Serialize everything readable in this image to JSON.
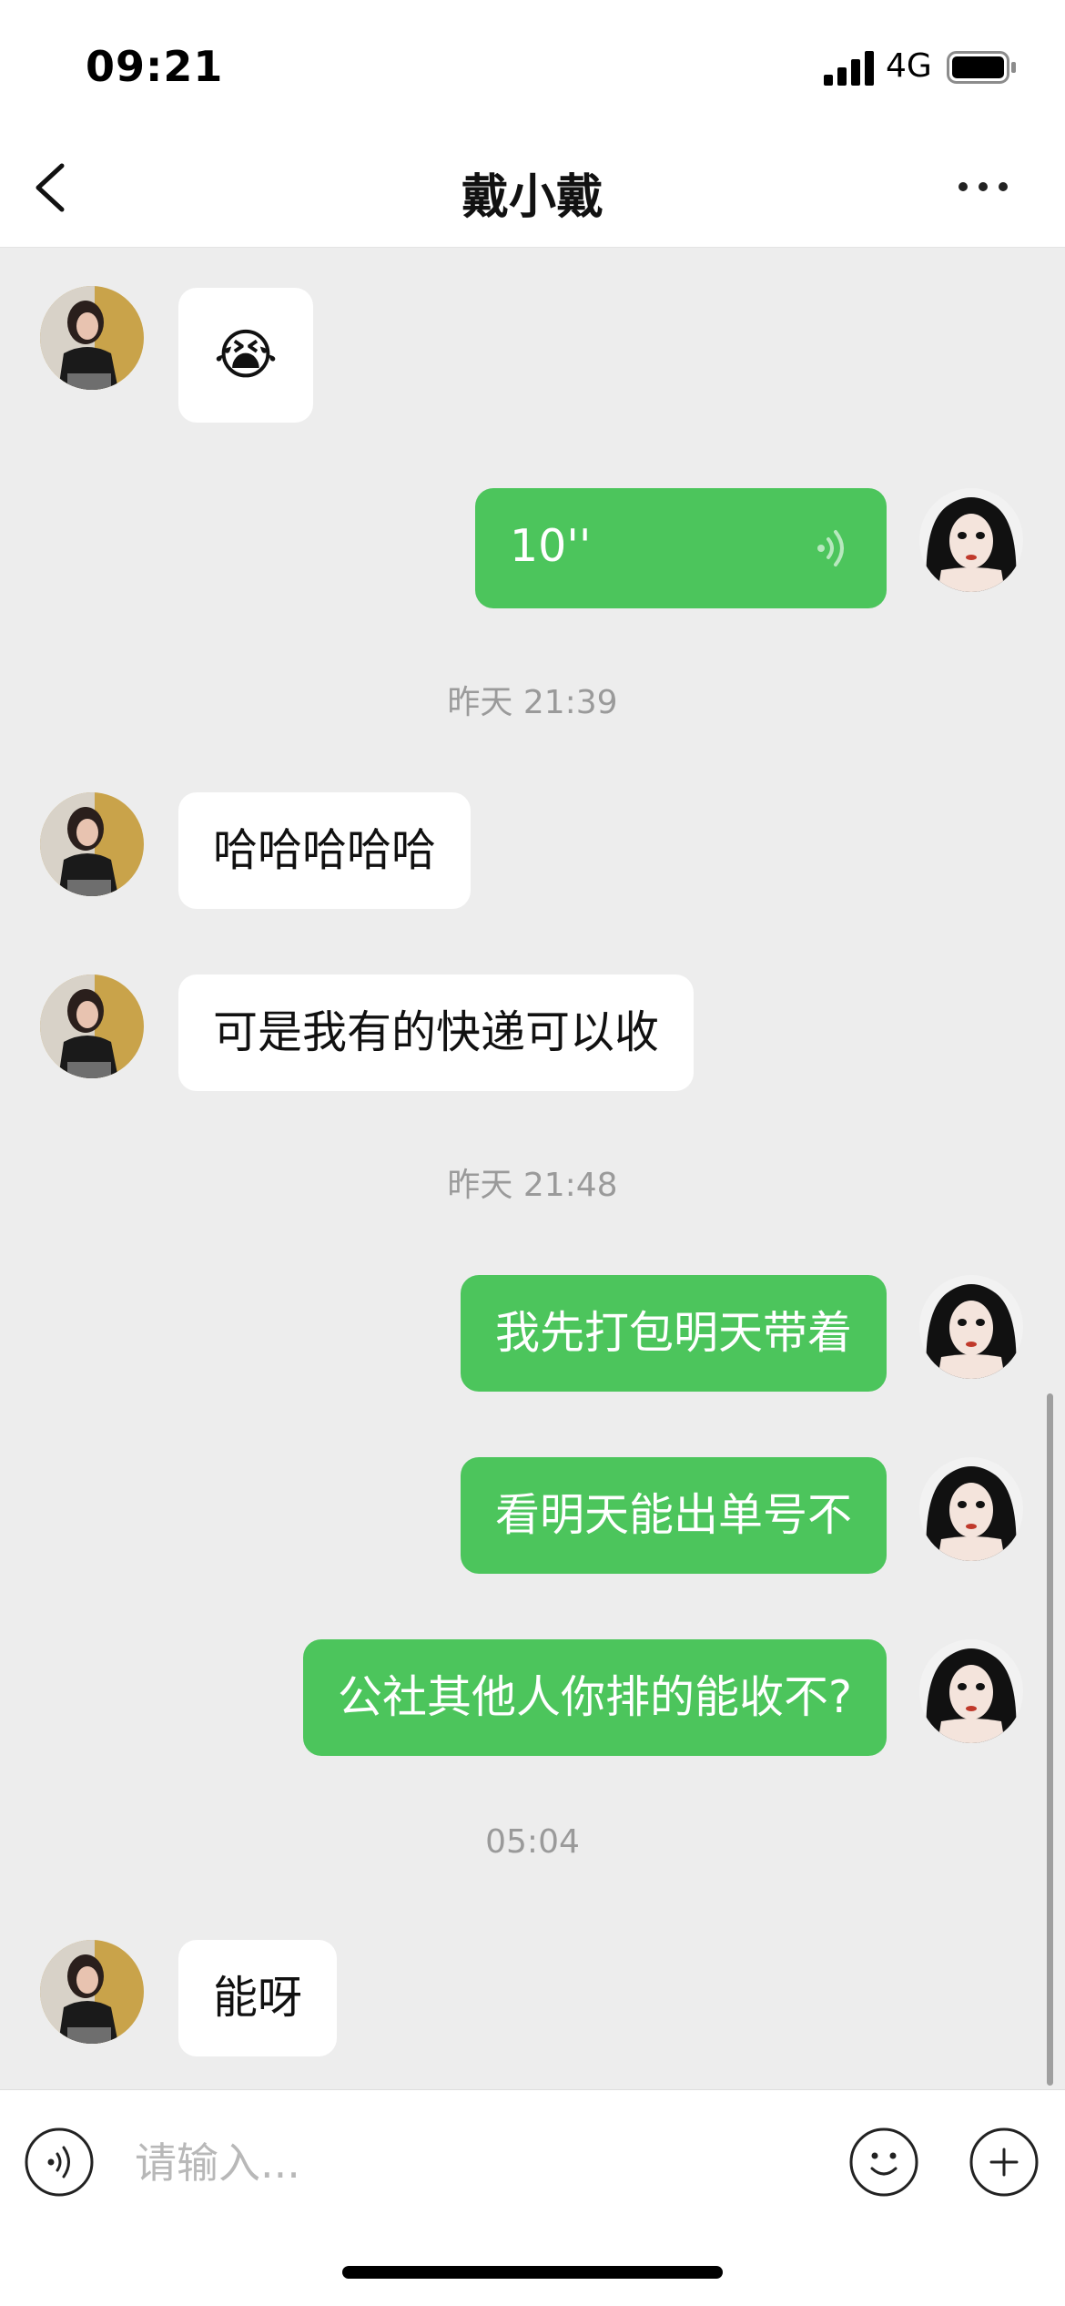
{
  "status_bar": {
    "time": "09:21",
    "network": "4G"
  },
  "nav": {
    "title": "戴小戴"
  },
  "messages": {
    "m1_emoji": "😭",
    "m2_voice": {
      "duration": "10''"
    },
    "ts1": "昨天 21:39",
    "m3": "哈哈哈哈哈",
    "m4": "可是我有的快递可以收",
    "ts2": "昨天 21:48",
    "m5": "我先打包明天带着",
    "m6": "看明天能出单号不",
    "m7": "公社其他人你排的能收不?",
    "ts3": "05:04",
    "m8": "能呀"
  },
  "input": {
    "placeholder": "请输入..."
  },
  "colors": {
    "outgoing_bubble": "#4cc55c",
    "incoming_bubble": "#ffffff",
    "chat_background": "#ededed"
  },
  "icons": [
    "back-chevron-icon",
    "more-icon",
    "voice-input-icon",
    "emoji-icon",
    "plus-icon",
    "voice-wave-icon",
    "signal-icon",
    "battery-icon"
  ]
}
